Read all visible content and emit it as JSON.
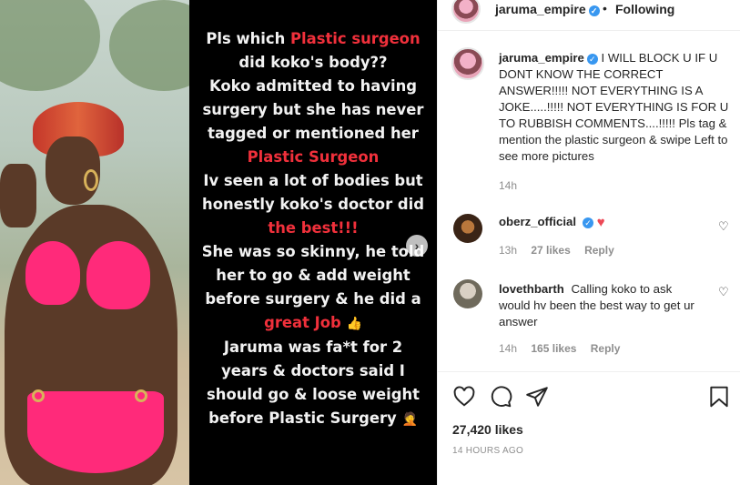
{
  "story": {
    "q1": "Pls which ",
    "q1_hl": "Plastic surgeon",
    "q2": "did koko's body??",
    "q3": "Koko admitted to having surgery but she has never tagged or mentioned her",
    "q3_hl": "Plastic Surgeon",
    "q4": "Iv seen a lot of bodies but honestly koko's doctor did",
    "q4_hl": "the best!!!",
    "q5": "She was so skinny, he told her to go & add weight before surgery & he did a",
    "q5_hl": "great Job",
    "q6": "Jaruma was fa*t for 2 years & doctors said I should go & loose weight before Plastic Surgery",
    "thumbs_emoji": "👍",
    "facepalm_emoji": "🤦"
  },
  "header": {
    "username": "jaruma_empire",
    "separator": "•",
    "follow_status": "Following"
  },
  "caption": {
    "username": "jaruma_empire",
    "text": "I WILL BLOCK U IF U DONT KNOW THE CORRECT ANSWER!!!!! NOT EVERYTHING IS A JOKE.....!!!!! NOT EVERYTHING IS FOR U TO RUBBISH COMMENTS....!!!!! Pls tag & mention the plastic surgeon & swipe Left to see more pictures",
    "time": "14h"
  },
  "comments": [
    {
      "username": "oberz_official",
      "text": "",
      "time": "13h",
      "likes": "27 likes",
      "reply": "Reply"
    },
    {
      "username": "lovethbarth",
      "text": "Calling koko to ask would hv been the best way to get ur answer",
      "time": "14h",
      "likes": "165 likes",
      "reply": "Reply"
    }
  ],
  "post": {
    "likes": "27,420 likes",
    "posted": "14 HOURS AGO"
  },
  "colors": {
    "accent_verified": "#3897f0",
    "highlight_red": "#f0303b",
    "heart_red": "#ed4956",
    "muted": "#8e8e8e"
  },
  "icons": [
    "verified-icon",
    "heart-icon",
    "comment-icon",
    "share-icon",
    "bookmark-icon",
    "chevron-right-icon"
  ]
}
